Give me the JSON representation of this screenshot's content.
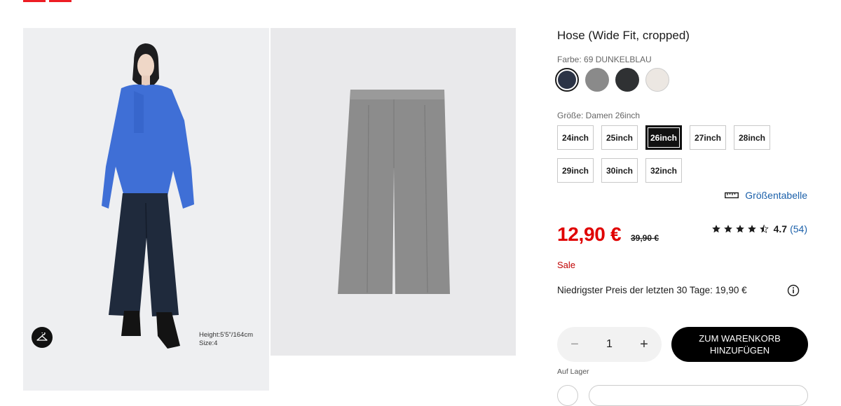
{
  "product": {
    "title": "Hose (Wide Fit, cropped)",
    "color_label": "Farbe: 69 DUNKELBLAU",
    "colors": [
      {
        "name": "navy",
        "hex": "#2c3446",
        "selected": true
      },
      {
        "name": "gray",
        "hex": "#8a8a8a",
        "selected": false
      },
      {
        "name": "dark-gray",
        "hex": "#2f3133",
        "selected": false
      },
      {
        "name": "off-white",
        "hex": "#ece7e2",
        "selected": false
      }
    ],
    "size_label": "Größe: Damen 26inch",
    "sizes": [
      {
        "label": "24inch",
        "selected": false
      },
      {
        "label": "25inch",
        "selected": false
      },
      {
        "label": "26inch",
        "selected": true
      },
      {
        "label": "27inch",
        "selected": false
      },
      {
        "label": "28inch",
        "selected": false
      },
      {
        "label": "29inch",
        "selected": false
      },
      {
        "label": "30inch",
        "selected": false
      },
      {
        "label": "32inch",
        "selected": false
      }
    ],
    "size_chart_label": "Größentabelle",
    "price": "12,90 €",
    "old_price": "39,90 €",
    "rating": {
      "stars": 4.5,
      "value": "4.7",
      "count": "(54)"
    },
    "sale_label": "Sale",
    "lowest_price_text": "Niedrigster Preis der letzten 30 Tage: 19,90 €",
    "quantity": "1",
    "cart_button_line1": "ZUM WARENKORB",
    "cart_button_line2": "HINZUFÜGEN",
    "stock_label": "Auf Lager"
  },
  "gallery": {
    "model_height": "Height:5'5\"/164cm",
    "model_size": "Size:4"
  },
  "colors": {
    "brand_red": "#ed1d24",
    "price_red": "#e00000",
    "link_blue": "#1b60aa"
  }
}
